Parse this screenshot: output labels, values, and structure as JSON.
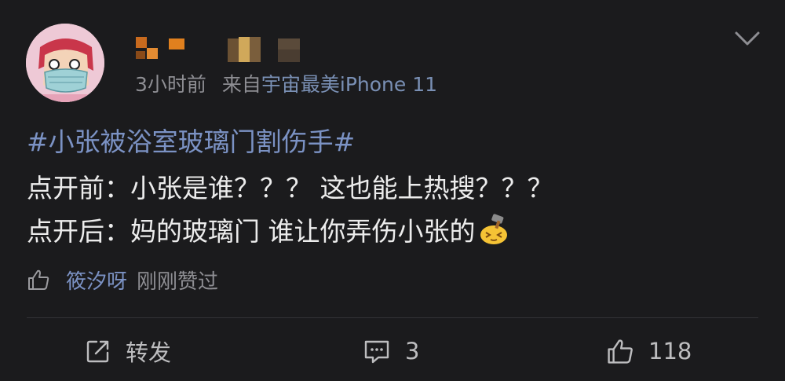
{
  "post": {
    "time": "3小时前",
    "source_prefix": "来自",
    "source": "宇宙最美iPhone 11",
    "topic": "#小张被浴室玻璃门割伤手#",
    "line1": "点开前：小张是谁？？？ 这也能上热搜？？？",
    "line2": "点开后：妈的玻璃门 谁让你弄伤小张的"
  },
  "liked_by": {
    "user": "筱汐呀",
    "text": "刚刚赞过"
  },
  "actions": {
    "repost_label": "转发",
    "comment_count": "3",
    "like_count": "118"
  },
  "icons": {
    "more": "chevron-down-icon",
    "liked": "thumb-up-icon",
    "repost": "share-icon",
    "comment": "comment-icon",
    "like": "thumb-up-icon",
    "emoji": "hammer-face-emoji"
  },
  "colors": {
    "background": "#1b1b1d",
    "topic": "#7b92c4",
    "meta": "#8e8e93",
    "text": "#ececec"
  }
}
